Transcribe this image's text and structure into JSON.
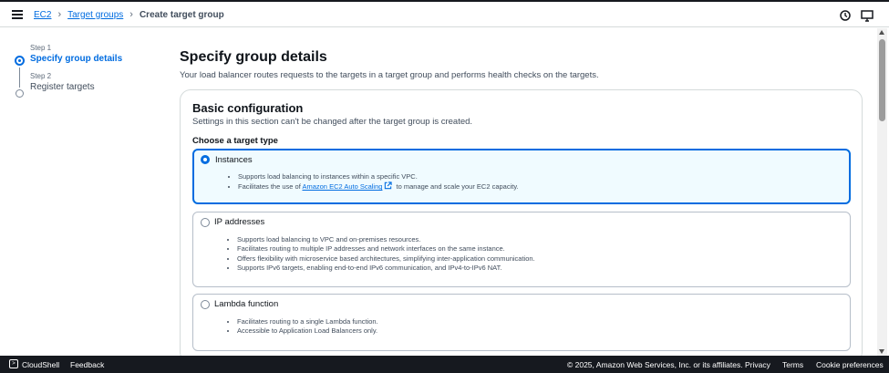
{
  "breadcrumb": {
    "items": [
      {
        "label": "EC2"
      },
      {
        "label": "Target groups"
      }
    ],
    "current": "Create target group"
  },
  "steps": [
    {
      "step_label": "Step 1",
      "name": "Specify group details",
      "state": "active"
    },
    {
      "step_label": "Step 2",
      "name": "Register targets",
      "state": "idle"
    }
  ],
  "page": {
    "title": "Specify group details",
    "description": "Your load balancer routes requests to the targets in a target group and performs health checks on the targets."
  },
  "basic_config": {
    "title": "Basic configuration",
    "description": "Settings in this section can't be changed after the target group is created.",
    "choose_label": "Choose a target type",
    "options": [
      {
        "label": "Instances",
        "selected": true,
        "bullets": [
          "Supports load balancing to instances within a specific VPC."
        ],
        "bullet_link": {
          "prefix": "Facilitates the use of ",
          "link": "Amazon EC2 Auto Scaling",
          "suffix": " to manage and scale your EC2 capacity."
        }
      },
      {
        "label": "IP addresses",
        "selected": false,
        "bullets": [
          "Supports load balancing to VPC and on-premises resources.",
          "Facilitates routing to multiple IP addresses and network interfaces on the same instance.",
          "Offers flexibility with microservice based architectures, simplifying inter-application communication.",
          "Supports IPv6 targets, enabling end-to-end IPv6 communication, and IPv4-to-IPv6 NAT."
        ]
      },
      {
        "label": "Lambda function",
        "selected": false,
        "bullets": [
          "Facilitates routing to a single Lambda function.",
          "Accessible to Application Load Balancers only."
        ]
      }
    ]
  },
  "footer": {
    "cloudshell": "CloudShell",
    "feedback": "Feedback",
    "copyright": "© 2025, Amazon Web Services, Inc. or its affiliates.",
    "privacy": "Privacy",
    "terms": "Terms",
    "cookies": "Cookie preferences"
  },
  "colors": {
    "accent": "#006ce0",
    "selected_bg": "#f0fbff",
    "footer_bg": "#16191f"
  },
  "icons": [
    "menu-icon",
    "history-icon",
    "screen-icon",
    "external-link-icon",
    "cloudshell-icon"
  ]
}
